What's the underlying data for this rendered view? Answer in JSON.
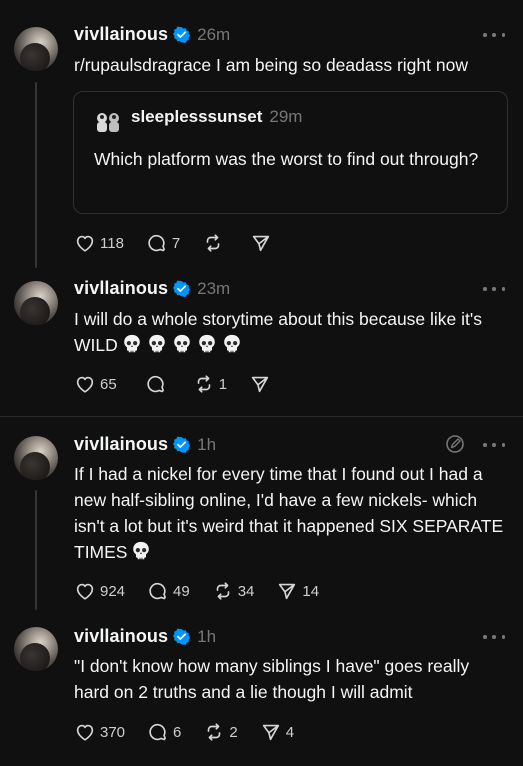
{
  "posts": [
    {
      "username": "vivllainous",
      "time": "26m",
      "text": "r/rupaulsdragrace I am being so deadass right now",
      "quote": {
        "username": "sleeplesssunset",
        "time": "29m",
        "text": "Which platform was the worst to find out through?"
      },
      "likes": "118",
      "replies": "7",
      "reposts": "",
      "shares": ""
    },
    {
      "username": "vivllainous",
      "time": "23m",
      "text": "I will do a whole storytime about this because like it's WILD",
      "emoji_count": 5,
      "likes": "65",
      "replies": "",
      "reposts": "1",
      "shares": ""
    },
    {
      "username": "vivllainous",
      "time": "1h",
      "text": "If I had a nickel for every time that I found out I had a new half-sibling online, I'd have a few nickels- which isn't a lot but it's weird that it happened SIX SEPARATE TIMES",
      "emoji_count": 1,
      "likes": "924",
      "replies": "49",
      "reposts": "34",
      "shares": "14"
    },
    {
      "username": "vivllainous",
      "time": "1h",
      "text": "\"I don't know how many siblings I have\" goes really hard on 2 truths and a lie though I will admit",
      "likes": "370",
      "replies": "6",
      "reposts": "2",
      "shares": "4"
    }
  ],
  "colors": {
    "background": "#101010",
    "text": "#f3f5f7",
    "muted": "#777777",
    "verified": "#0095f6",
    "divider": "#2a2a2a"
  },
  "icons": [
    "verified-badge-icon",
    "more-icon",
    "heart-icon",
    "reply-icon",
    "repost-icon",
    "share-icon",
    "skull-icon",
    "edit-icon"
  ]
}
